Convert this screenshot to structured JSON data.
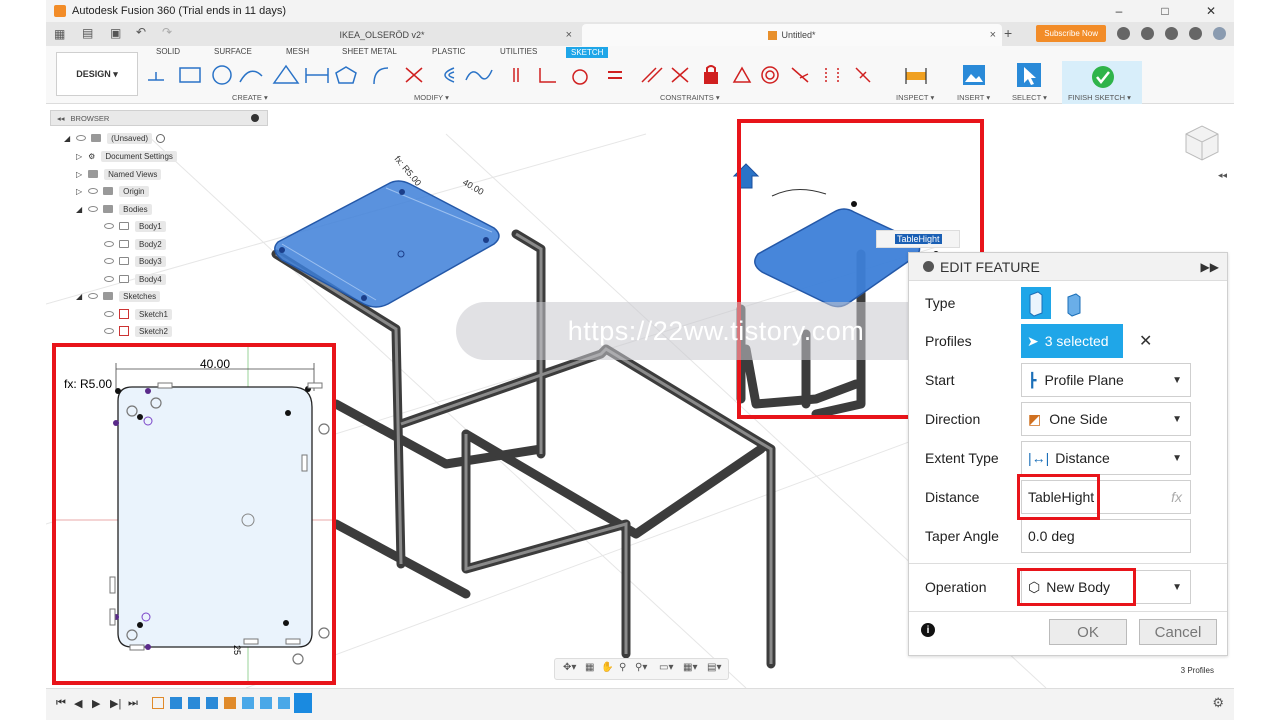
{
  "app": {
    "title": "Autodesk Fusion 360 (Trial ends in 11 days)",
    "window_controls": [
      "–",
      "□",
      "✕"
    ]
  },
  "tabs": {
    "doc1": "IKEA_OLSERÖD v2*",
    "doc2": "Untitled*",
    "subscribe": "Subscribe Now"
  },
  "toolbar": {
    "design": "DESIGN ▾",
    "workspace_tabs": [
      "SOLID",
      "SURFACE",
      "MESH",
      "SHEET METAL",
      "PLASTIC",
      "UTILITIES",
      "SKETCH"
    ],
    "groups": [
      "CREATE ▾",
      "MODIFY ▾",
      "CONSTRAINTS ▾",
      "INSPECT ▾",
      "INSERT ▾",
      "SELECT ▾",
      "FINISH SKETCH ▾"
    ]
  },
  "browser": {
    "header": "BROWSER",
    "items": [
      {
        "label": "(Unsaved)"
      },
      {
        "label": "Document Settings"
      },
      {
        "label": "Named Views"
      },
      {
        "label": "Origin"
      },
      {
        "label": "Bodies"
      },
      {
        "label": "Body1"
      },
      {
        "label": "Body2"
      },
      {
        "label": "Body3"
      },
      {
        "label": "Body4"
      },
      {
        "label": "Sketches"
      },
      {
        "label": "Sketch1"
      },
      {
        "label": "Sketch2"
      }
    ]
  },
  "canvas": {
    "watermark": "https://22ww.tistory.com",
    "dim_width": "40.00",
    "dim_radius": "fx: R5.00",
    "dim_side": "25",
    "model_dim_radius": "fx: R5.00",
    "model_dim_width": "40.00",
    "table_hight_tag": "TableHight",
    "status": "3 Profiles"
  },
  "edit_feature": {
    "title": "EDIT FEATURE",
    "type_label": "Type",
    "profiles_label": "Profiles",
    "profiles_value": "3 selected",
    "start_label": "Start",
    "start_value": "Profile Plane",
    "direction_label": "Direction",
    "direction_value": "One Side",
    "extent_label": "Extent Type",
    "extent_value": "Distance",
    "distance_label": "Distance",
    "distance_value": "TableHight",
    "fx": "fx",
    "taper_label": "Taper Angle",
    "taper_value": "0.0 deg",
    "operation_label": "Operation",
    "operation_value": "New Body",
    "ok": "OK",
    "cancel": "Cancel"
  },
  "colors": {
    "accent": "#1fa6e8",
    "highlight": "#e8141a",
    "sketch_fill": "#3d7fd8"
  }
}
